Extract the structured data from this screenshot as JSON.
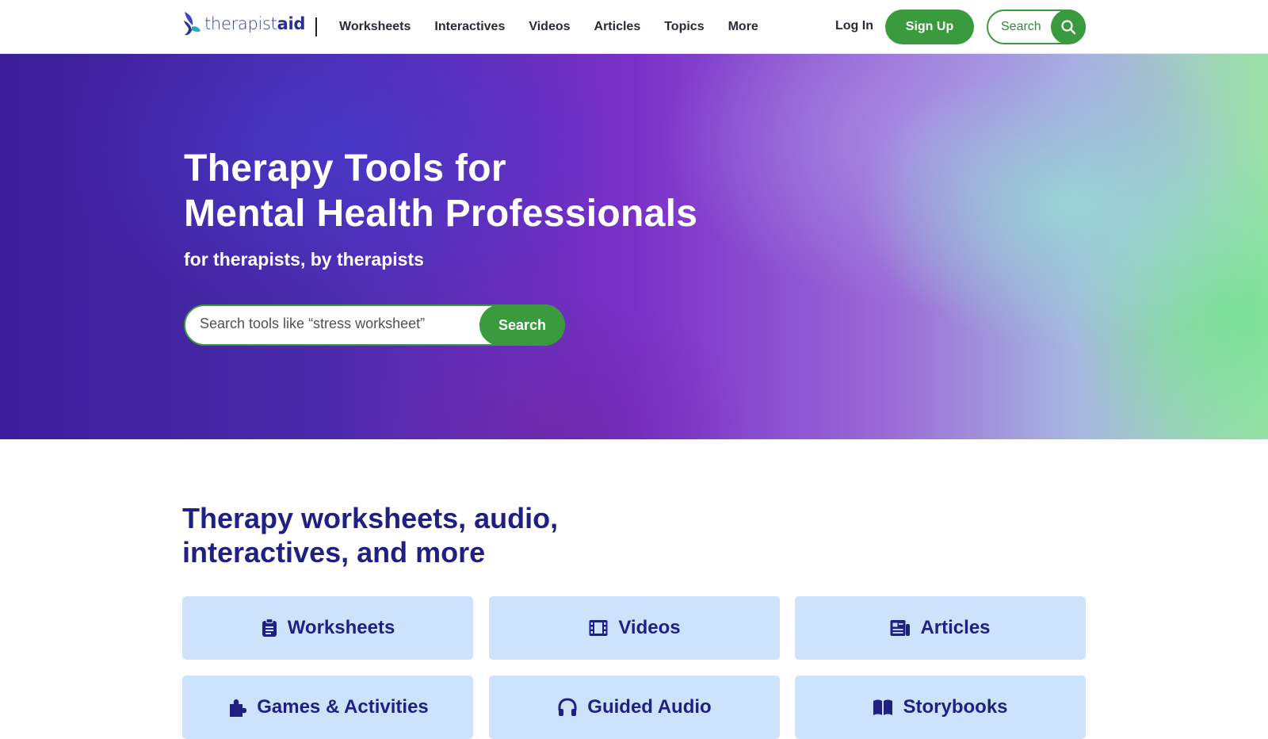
{
  "header": {
    "logo": {
      "light": "therapist",
      "bold": "aid"
    },
    "nav": [
      "Worksheets",
      "Interactives",
      "Videos",
      "Articles",
      "Topics",
      "More"
    ],
    "login_label": "Log In",
    "signup_label": "Sign Up",
    "search_label": "Search",
    "search_icon": "magnifier-icon"
  },
  "hero": {
    "title_line1": "Therapy Tools for",
    "title_line2": "Mental Health Professionals",
    "subtitle": "for therapists, by therapists",
    "search_placeholder": "Search tools like “stress worksheet”",
    "search_button": "Search"
  },
  "section": {
    "title_line1": "Therapy worksheets, audio,",
    "title_line2": "interactives, and more",
    "cards": [
      {
        "label": "Worksheets",
        "icon": "clipboard-icon"
      },
      {
        "label": "Videos",
        "icon": "film-icon"
      },
      {
        "label": "Articles",
        "icon": "newspaper-icon"
      },
      {
        "label": "Games & Activities",
        "icon": "puzzle-icon"
      },
      {
        "label": "Guided Audio",
        "icon": "headphones-icon"
      },
      {
        "label": "Storybooks",
        "icon": "book-icon"
      }
    ]
  },
  "colors": {
    "brand_green": "#3a9a3e",
    "brand_navy": "#1f1f84",
    "card_bg": "#cde3fb"
  }
}
